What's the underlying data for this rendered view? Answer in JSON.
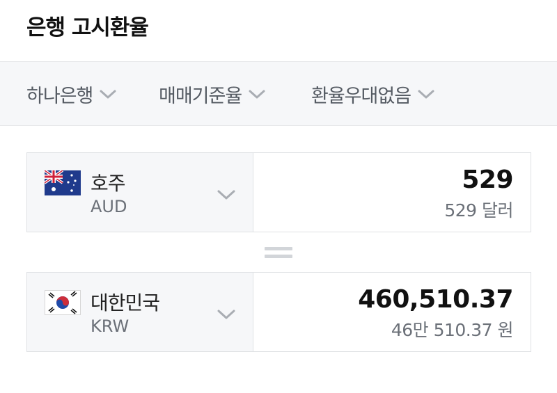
{
  "page": {
    "title": "은행 고시환율"
  },
  "filters": [
    {
      "label": "하나은행",
      "icon": "chevron-down-icon"
    },
    {
      "label": "매매기준율",
      "icon": "chevron-down-icon"
    },
    {
      "label": "환율우대없음",
      "icon": "chevron-down-icon"
    }
  ],
  "from_currency": {
    "name": "호주",
    "code": "AUD",
    "flag": "australia-flag-icon",
    "amount": "529",
    "amount_text": "529 달러"
  },
  "equals_symbol": "equals-icon",
  "to_currency": {
    "name": "대한민국",
    "code": "KRW",
    "flag": "south-korea-flag-icon",
    "amount": "460,510.37",
    "amount_text": "46만 510.37 원"
  },
  "colors": {
    "bar_background": "#f6f7f9",
    "border": "#dfe1e4",
    "muted_text": "#6b7078",
    "chevron": "#a9adb3"
  }
}
